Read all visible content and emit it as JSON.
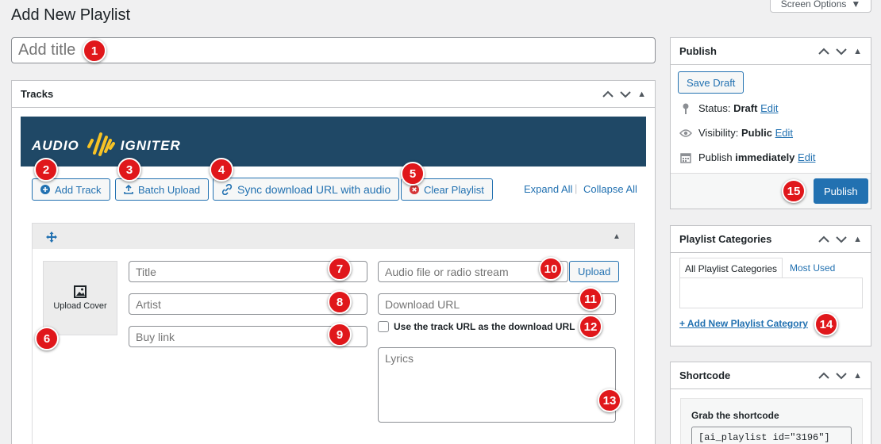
{
  "page": {
    "title": "Add New Playlist",
    "screen_options": "Screen Options"
  },
  "title_field": {
    "placeholder": "Add title"
  },
  "tracks_box": {
    "heading": "Tracks",
    "brand_left": "AUDIO",
    "brand_right": "IGNITER",
    "buttons": {
      "add_track": "Add Track",
      "batch_upload": "Batch Upload",
      "sync_download": "Sync download URL with audio",
      "clear_playlist": "Clear Playlist"
    },
    "expand_all": "Expand All",
    "collapse_all": "Collapse All",
    "track": {
      "upload_cover": "Upload Cover",
      "title_placeholder": "Title",
      "artist_placeholder": "Artist",
      "buy_link_placeholder": "Buy link",
      "audio_placeholder": "Audio file or radio stream",
      "upload_button": "Upload",
      "download_placeholder": "Download URL",
      "use_track_url_label": "Use the track URL as the download URL",
      "lyrics_placeholder": "Lyrics"
    }
  },
  "publish_box": {
    "heading": "Publish",
    "save_draft": "Save Draft",
    "status_label": "Status:",
    "status_value": "Draft",
    "visibility_label": "Visibility:",
    "visibility_value": "Public",
    "publish_label": "Publish",
    "publish_value": "immediately",
    "edit": "Edit",
    "publish_button": "Publish"
  },
  "categories_box": {
    "heading": "Playlist Categories",
    "tab_all": "All Playlist Categories",
    "tab_most_used": "Most Used",
    "add_new": "+ Add New Playlist Category"
  },
  "shortcode_box": {
    "heading": "Shortcode",
    "grab_label": "Grab the shortcode",
    "code": "[ai_playlist id=\"3196\"]"
  },
  "badges": [
    "1",
    "2",
    "3",
    "4",
    "5",
    "6",
    "7",
    "8",
    "9",
    "10",
    "11",
    "12",
    "13",
    "14",
    "15"
  ],
  "colors": {
    "accent": "#2271b1",
    "banner": "#1f4866",
    "badge": "#e0171b",
    "logo_yellow": "#f7c325"
  }
}
